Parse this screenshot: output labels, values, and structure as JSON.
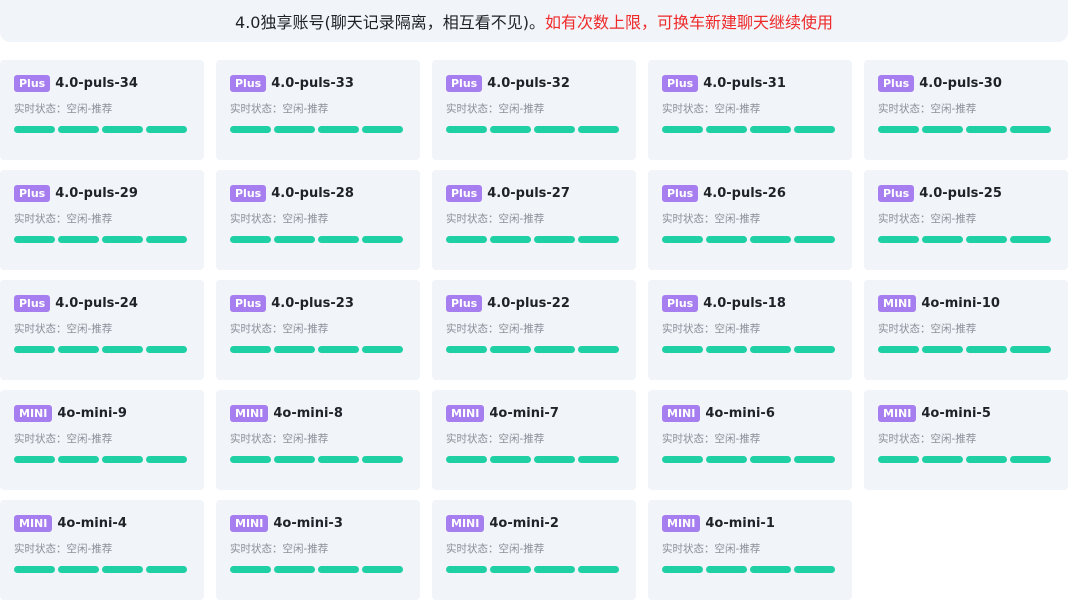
{
  "notice": {
    "main_text": "4.0独享账号(聊天记录隔离，相互看不见)。",
    "alert_text": "如有次数上限，可换车新建聊天继续使用"
  },
  "colors": {
    "badge_bg": "#a77ef0",
    "bar_fill": "#20d0a5",
    "alert_text": "#ee2a2a",
    "card_bg": "#f1f4f8"
  },
  "accounts": [
    {
      "badge": "Plus",
      "name": "4.0-puls-34",
      "status": "实时状态：空闲-推荐"
    },
    {
      "badge": "Plus",
      "name": "4.0-puls-33",
      "status": "实时状态：空闲-推荐"
    },
    {
      "badge": "Plus",
      "name": "4.0-puls-32",
      "status": "实时状态：空闲-推荐"
    },
    {
      "badge": "Plus",
      "name": "4.0-puls-31",
      "status": "实时状态：空闲-推荐"
    },
    {
      "badge": "Plus",
      "name": "4.0-puls-30",
      "status": "实时状态：空闲-推荐"
    },
    {
      "badge": "Plus",
      "name": "4.0-puls-29",
      "status": "实时状态：空闲-推荐"
    },
    {
      "badge": "Plus",
      "name": "4.0-puls-28",
      "status": "实时状态：空闲-推荐"
    },
    {
      "badge": "Plus",
      "name": "4.0-puls-27",
      "status": "实时状态：空闲-推荐"
    },
    {
      "badge": "Plus",
      "name": "4.0-puls-26",
      "status": "实时状态：空闲-推荐"
    },
    {
      "badge": "Plus",
      "name": "4.0-puls-25",
      "status": "实时状态：空闲-推荐"
    },
    {
      "badge": "Plus",
      "name": "4.0-puls-24",
      "status": "实时状态：空闲-推荐"
    },
    {
      "badge": "Plus",
      "name": "4.0-plus-23",
      "status": "实时状态：空闲-推荐"
    },
    {
      "badge": "Plus",
      "name": "4.0-plus-22",
      "status": "实时状态：空闲-推荐"
    },
    {
      "badge": "Plus",
      "name": "4.0-puls-18",
      "status": "实时状态：空闲-推荐"
    },
    {
      "badge": "MINI",
      "name": "4o-mini-10",
      "status": "实时状态：空闲-推荐"
    },
    {
      "badge": "MINI",
      "name": "4o-mini-9",
      "status": "实时状态：空闲-推荐"
    },
    {
      "badge": "MINI",
      "name": "4o-mini-8",
      "status": "实时状态：空闲-推荐"
    },
    {
      "badge": "MINI",
      "name": "4o-mini-7",
      "status": "实时状态：空闲-推荐"
    },
    {
      "badge": "MINI",
      "name": "4o-mini-6",
      "status": "实时状态：空闲-推荐"
    },
    {
      "badge": "MINI",
      "name": "4o-mini-5",
      "status": "实时状态：空闲-推荐"
    },
    {
      "badge": "MINI",
      "name": "4o-mini-4",
      "status": "实时状态：空闲-推荐"
    },
    {
      "badge": "MINI",
      "name": "4o-mini-3",
      "status": "实时状态：空闲-推荐"
    },
    {
      "badge": "MINI",
      "name": "4o-mini-2",
      "status": "实时状态：空闲-推荐"
    },
    {
      "badge": "MINI",
      "name": "4o-mini-1",
      "status": "实时状态：空闲-推荐"
    }
  ]
}
